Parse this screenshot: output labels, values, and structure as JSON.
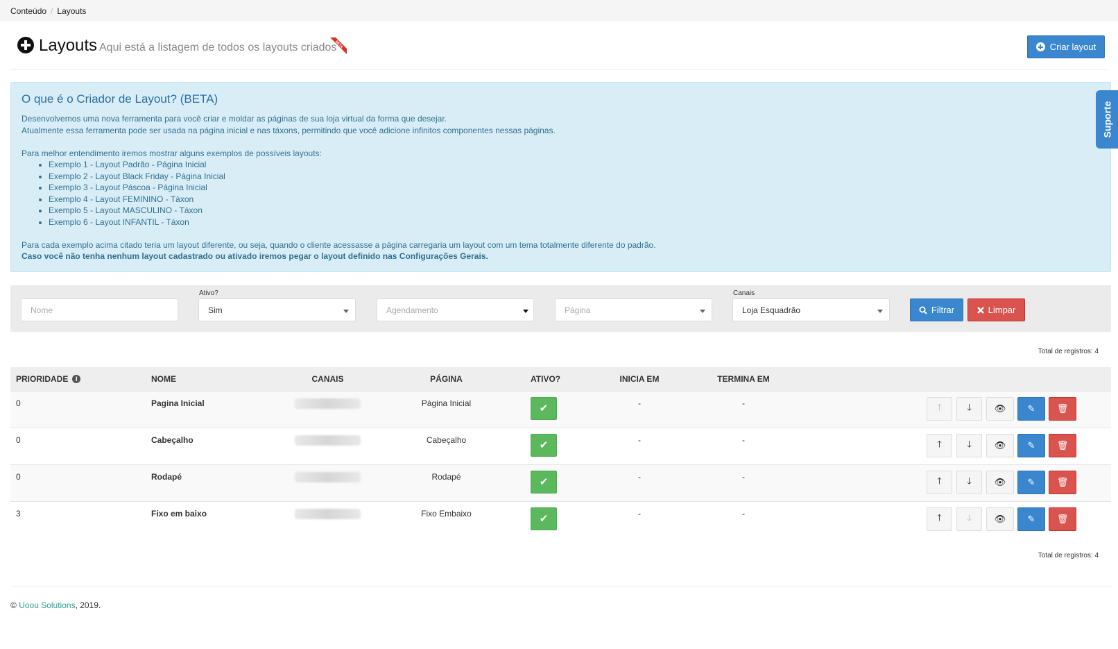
{
  "breadcrumb": {
    "items": [
      "Conteúdo",
      "Layouts"
    ],
    "separator": "/"
  },
  "header": {
    "title": "Layouts",
    "subtitle": "Aqui está a listagem de todos os layouts criados",
    "badge": "BETA",
    "create_button": "Criar layout"
  },
  "info": {
    "title": "O que é o Criador de Layout? (BETA)",
    "line1": "Desenvolvemos uma nova ferramenta para você criar e moldar as páginas de sua loja virtual da forma que desejar.",
    "line2": "Atualmente essa ferramenta pode ser usada na página inicial e nas táxons, permitindo que você adicione infinitos componentes nessas páginas.",
    "examples_intro": "Para melhor entendimento iremos mostrar alguns exemplos de possíveis layouts:",
    "examples": [
      "Exemplo 1 - Layout Padrão - Página Inicial",
      "Exemplo 2 - Layout Black Friday - Página Inicial",
      "Exemplo 3 - Layout Páscoa - Página Inicial",
      "Exemplo 4 - Layout FEMININO - Táxon",
      "Exemplo 5 - Layout MASCULINO - Táxon",
      "Exemplo 6 - Layout INFANTIL - Táxon"
    ],
    "footer_text": "Para cada exemplo acima citado teria um layout diferente, ou seja, quando o cliente acessasse a página carregaria um layout com um tema totalmente diferente do padrão.",
    "footer_bold": "Caso você não tenha nenhum layout cadastrado ou ativado iremos pegar o layout definido nas Configurações Gerais."
  },
  "support_tab": "Suporte",
  "filters": {
    "name_placeholder": "Nome",
    "active_label": "Ativo?",
    "active_value": "Sim",
    "schedule_placeholder": "Agendamento",
    "page_placeholder": "Página",
    "channels_label": "Canais",
    "channels_value": "Loja Esquadrão",
    "filter_button": "Filtrar",
    "clear_button": "Limpar"
  },
  "total_text": "Total de registros: 4",
  "table": {
    "headers": {
      "priority": "Prioridade",
      "name": "Nome",
      "channels": "Canais",
      "page": "Página",
      "active": "Ativo?",
      "starts": "Inicia em",
      "ends": "Termina em"
    },
    "rows": [
      {
        "priority": "0",
        "name": "Pagina Inicial",
        "page": "Página Inicial",
        "starts": "-",
        "ends": "-",
        "can_up": false,
        "can_down": true
      },
      {
        "priority": "0",
        "name": "Cabeçalho",
        "page": "Cabeçalho",
        "starts": "-",
        "ends": "-",
        "can_up": true,
        "can_down": true
      },
      {
        "priority": "0",
        "name": "Rodapé",
        "page": "Rodapé",
        "starts": "-",
        "ends": "-",
        "can_up": true,
        "can_down": true
      },
      {
        "priority": "3",
        "name": "Fixo em baixo",
        "page": "Fixo Embaixo",
        "starts": "-",
        "ends": "-",
        "can_up": true,
        "can_down": false
      }
    ]
  },
  "footer": {
    "symbol": "©",
    "company": "Uoou Solutions",
    "year": ", 2019."
  },
  "colors": {
    "primary": "#3a87d0",
    "danger": "#d9534f",
    "success": "#5cb85c",
    "info_bg": "#d9edf7"
  }
}
